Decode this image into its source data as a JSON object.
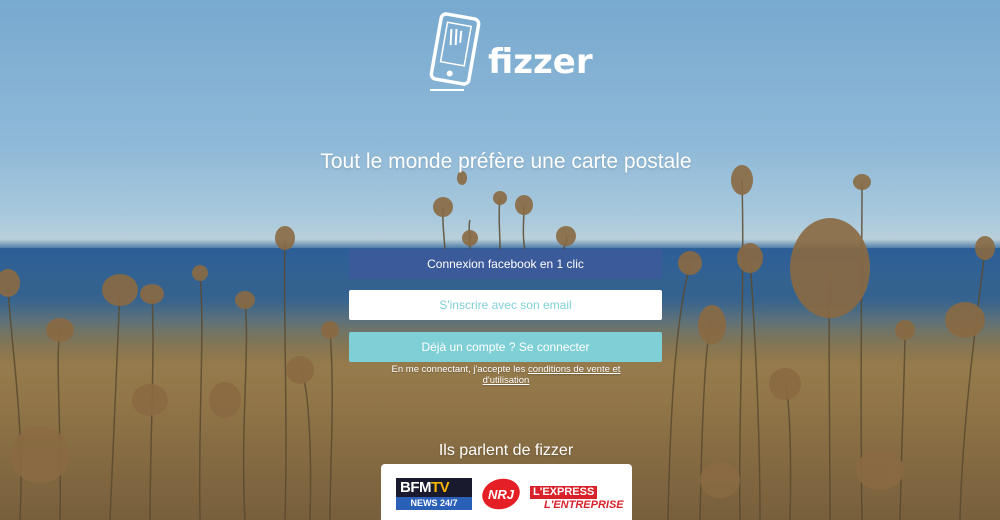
{
  "brand": {
    "name": "fizzer",
    "icon": "phone-postcard-icon"
  },
  "hero": {
    "tagline": "Tout le monde préfère une carte postale"
  },
  "auth": {
    "facebook_label": "Connexion facebook en 1 clic",
    "email_signup_label": "S'inscrire avec son email",
    "login_label": "Déjà un compte ? Se connecter",
    "legal_prefix": "En me connectant, j'accepte les",
    "legal_link": "conditions de vente et d'utilisation"
  },
  "press": {
    "title": "Ils parlent de fizzer",
    "logos": [
      {
        "name": "bfm-tv-logo",
        "line1_a": "BFM",
        "line1_b": "TV",
        "line2": "NEWS 24/7"
      },
      {
        "name": "nrj-logo",
        "text": "NRJ"
      },
      {
        "name": "lexpress-entreprise-logo",
        "line1": "L'EXPRESS",
        "line2": "L'ENTREPRISE"
      }
    ]
  },
  "colors": {
    "facebook": "#3b5a9a",
    "accent": "#7fd0d6",
    "white": "#ffffff"
  }
}
